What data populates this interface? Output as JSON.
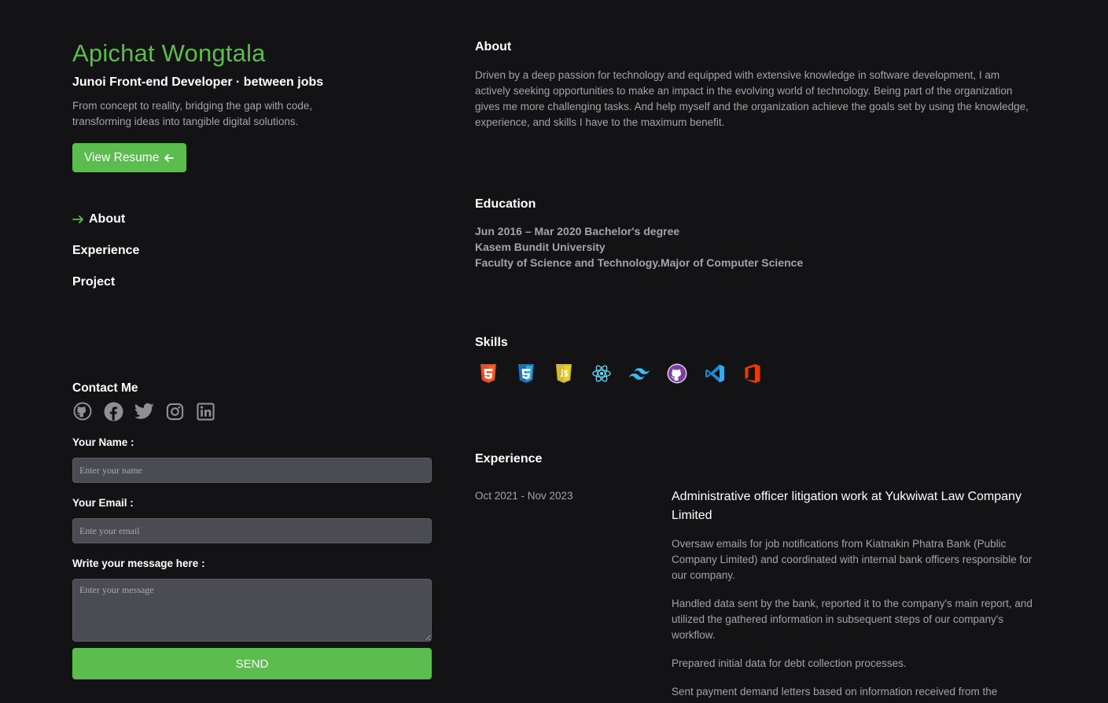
{
  "profile": {
    "name": "Apichat Wongtala",
    "role": "Junoi Front-end Developer · between jobs",
    "tagline": "From concept to reality, bridging the gap with code, transforming ideas into tangible digital solutions.",
    "resume_label": "View Resume"
  },
  "nav": {
    "items": [
      {
        "label": "About",
        "active": true
      },
      {
        "label": "Experience",
        "active": false
      },
      {
        "label": "Project",
        "active": false
      }
    ]
  },
  "contact": {
    "title": "Contact Me",
    "socials": [
      "github-icon",
      "facebook-icon",
      "twitter-icon",
      "instagram-icon",
      "linkedin-icon"
    ],
    "name_label": "Your Name :",
    "name_placeholder": "Enter your name",
    "email_label": "Your Email :",
    "email_placeholder": "Ente your email",
    "message_label": "Write your message here :",
    "message_placeholder": "Enter your message",
    "send_label": "SEND"
  },
  "about": {
    "title": "About",
    "text": "Driven by a deep passion for technology and equipped with extensive knowledge in software development, I am actively seeking opportunities to make an impact in the evolving world of technology. Being part of the organization gives me more challenging tasks. And help myself and the organization achieve the goals set by using the knowledge, experience, and skills I have to the maximum benefit."
  },
  "education": {
    "title": "Education",
    "period_degree": "Jun 2016 – Mar 2020 Bachelor's degree",
    "school": "Kasem Bundit University",
    "faculty": "Faculty of Science and Technology.Major of Computer Science"
  },
  "skills": {
    "title": "Skills",
    "icons": [
      "html5-icon",
      "css3-icon",
      "javascript-icon",
      "react-icon",
      "tailwind-icon",
      "github-icon",
      "vscode-icon",
      "office-icon"
    ]
  },
  "experience": {
    "title": "Experience",
    "items": [
      {
        "date": "Oct 2021 - Nov 2023",
        "role": "Administrative officer litigation work at Yukwiwat Law Company Limited",
        "points": [
          "Oversaw emails for job notifications from Kiatnakin Phatra Bank (Public Company Limited) and coordinated with internal bank officers responsible for our company.",
          "Handled data sent by the bank, reported it to the company's main report, and utilized the gathered information in subsequent steps of our company's workflow.",
          "Prepared initial data for debt collection processes.",
          "Sent payment demand letters based on information received from the"
        ]
      }
    ]
  },
  "colors": {
    "accent": "#5bbd4e",
    "background": "#131315",
    "muted_text": "#a2a4aa",
    "input_bg": "#4a4b53"
  }
}
